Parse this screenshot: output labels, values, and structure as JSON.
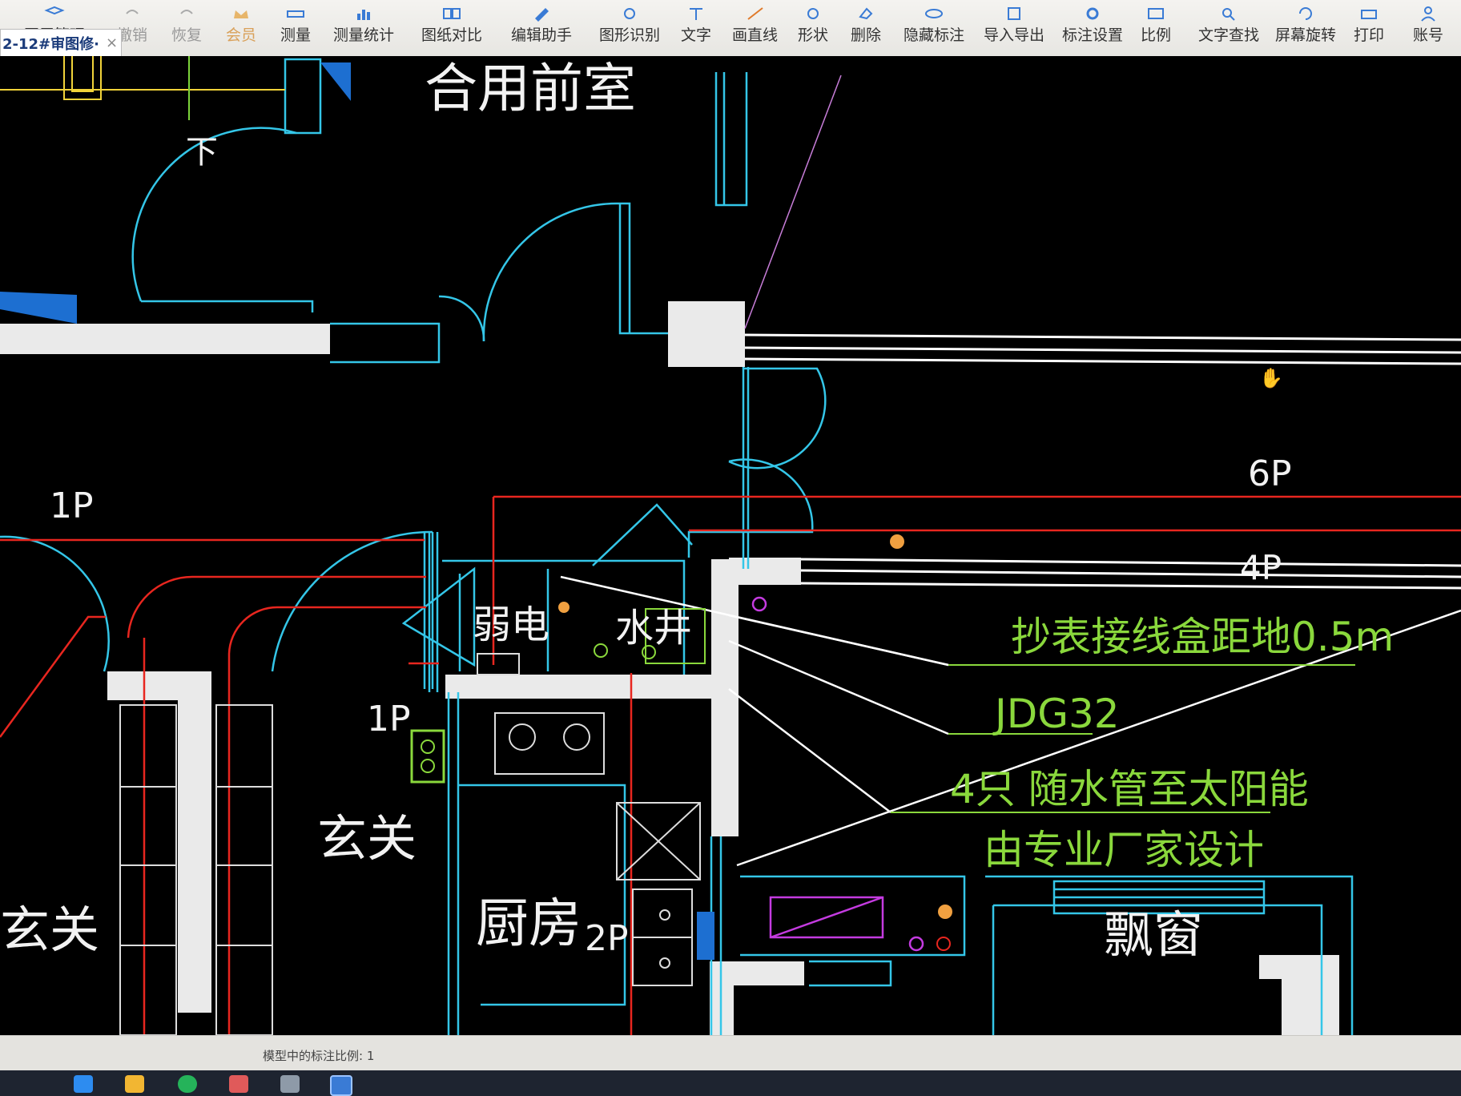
{
  "toolbar": {
    "items": [
      {
        "label": "图层管理",
        "state": "normal"
      },
      {
        "label": "撤销",
        "state": "muted"
      },
      {
        "label": "恢复",
        "state": "muted"
      },
      {
        "label": "会员",
        "state": "member"
      },
      {
        "label": "测量",
        "state": "normal"
      },
      {
        "label": "测量统计",
        "state": "normal"
      },
      {
        "label": "图纸对比",
        "state": "normal"
      },
      {
        "label": "编辑助手",
        "state": "normal"
      },
      {
        "label": "图形识别",
        "state": "normal"
      },
      {
        "label": "文字",
        "state": "normal"
      },
      {
        "label": "画直线",
        "state": "normal"
      },
      {
        "label": "形状",
        "state": "normal"
      },
      {
        "label": "删除",
        "state": "normal"
      },
      {
        "label": "隐藏标注",
        "state": "normal"
      },
      {
        "label": "导入导出",
        "state": "normal"
      },
      {
        "label": "标注设置",
        "state": "normal"
      },
      {
        "label": "比例",
        "state": "normal"
      },
      {
        "label": "文字查找",
        "state": "normal"
      },
      {
        "label": "屏幕旋转",
        "state": "normal"
      },
      {
        "label": "打印",
        "state": "normal"
      },
      {
        "label": "账号",
        "state": "normal"
      }
    ]
  },
  "document_tab": {
    "title": "2-12#审图修·",
    "close_glyph": "×"
  },
  "drawing": {
    "room_labels": {
      "shared_lobby": "合用前室",
      "entry_right": "玄关",
      "entry_left": "玄关",
      "kitchen": "厨房",
      "bay_window": "飘窗",
      "weak_current": "弱电",
      "water_shaft": "水井",
      "down_mark": "下"
    },
    "circuit_labels": {
      "p1_top": "1P",
      "p1_mid": "1P",
      "p2": "2P",
      "p4": "4P",
      "p6": "6P"
    },
    "annotations": {
      "meter_box": "抄表接线盒距地0.5m",
      "conduit": "JDG32",
      "solar_line1": "4只 随水管至太阳能",
      "solar_line2": "由专业厂家设计"
    }
  },
  "status_bar": {
    "scale_text": "模型中的标注比例: 1"
  },
  "colors": {
    "background": "#000000",
    "wall": "#34c6e8",
    "circuit": "#e8261f",
    "annotation": "#8ad83c",
    "label": "#f2f2f2"
  }
}
